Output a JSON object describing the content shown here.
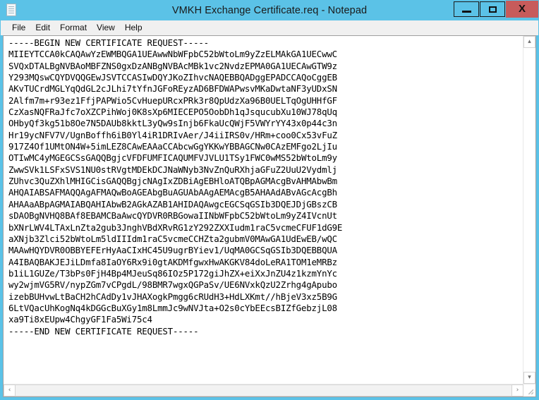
{
  "window": {
    "title": "VMKH Exchange Certificate.req - Notepad",
    "icon": "notepad-document-icon",
    "accent_color": "#5bc2e7",
    "close_button_color": "#c75b5b"
  },
  "titlebar_buttons": {
    "minimize": "–",
    "maximize": "□",
    "close": "X"
  },
  "menubar": {
    "items": [
      {
        "label": "File"
      },
      {
        "label": "Edit"
      },
      {
        "label": "Format"
      },
      {
        "label": "View"
      },
      {
        "label": "Help"
      }
    ]
  },
  "document": {
    "begin_marker": "-----BEGIN NEW CERTIFICATE REQUEST-----",
    "end_marker": "-----END NEW CERTIFICATE REQUEST-----",
    "body_lines": [
      "MIIEYTCCA0kCAQAwYzEWMBQGA1UEAwwNbWFpbC52bWtoLm9yZzELMAkGA1UECwwC",
      "SVQxDTALBgNVBAoMBFZNS0gxDzANBgNVBAcMBk1vc2NvdzEPMA0GA1UECAwGTW9z",
      "Y293MQswCQYDVQQGEwJSVTCCASIwDQYJKoZIhvcNAQEBBQADggEPADCCAQoCggEB",
      "AKvTUCrdMGLYqQdGL2cJLhi7tYfnJGFoREyzAD6BFDWAPwsvMKaDwtaNF3yUDxSN",
      "2Alfm7m+r93ez1FfjPAPWio5CvHuepURcxPRk3r8QpUdzXa96B0UELTqOgUHHfGF",
      "CzXasNQFRaJfc7oXZCPihWoj0K8sXp6MIECEPO5OobDh1qJsqucubXu10WJ78qUq",
      "OHbyQf3kg51b8Oe7N5DAUb8kktL3yQw9sInjb6FkaUcQWjF5VWYrYY43x0p44c3n",
      "Hr19ycNFV7V/UgnBoffh6iB0Yl4iR1DRIvAer/J4iiIRS0v/HRm+coo0Cx53vFuZ",
      "917Z4Of1UMtON4W+5imLEZ8CAwEAAaCCAbcwGgYKKwYBBAGCNw0CAzEMFgo2LjIu",
      "OTIwMC4yMGEGCSsGAQQBgjcVFDFUMFICAQUMFVJVLU1TSy1FWC0wMS52bWtoLm9y",
      "ZwwSVk1LSFxSVS1NU0stRVgtMDEkDCJNaWNyb3NvZnQuRXhjaGFuZ2UuU2Vydmlj",
      "ZUhvc3QuZXhlMHIGCisGAQQBgjcNAgIxZDBiAgEBHloATQBpAGMAcgBvAHMAbwBm",
      "AHQAIABSAFMAQQAgAFMAQwBoAGEAbgBuAGUAbAAgAEMAcgB5AHAAdABvAGcAcgBh",
      "AHAAaABpAGMAIABQAHIAbwB2AGkAZAB1AHIDAQAwgcEGCSqGSIb3DQEJDjGBszCB",
      "sDAOBgNVHQ8BAf8EBAMCBaAwcQYDVR0RBGowaIINbWFpbC52bWtoLm9yZ4IVcnUt",
      "bXNrLWV4LTAxLnZta2gub3JnghVBdXRvRG1zY292ZXXIudm1raC5vcmeCFUF1dG9E",
      "aXNjb3Zlci52bWtoLm5ldIIIdm1raC5vcmeCCHZta2gubmV0MAwGA1UdEwEB/wQC",
      "MAAwHQYDVR0OBBYEFErHyAaCIxHC45U9ugrBYiev1/UqMA0GCSqGSIb3DQEBBQUA",
      "A4IBAQBAKJEJiLDmfa8IaOY6Rx9i0gtAKDMfgwxHwAKGKV84doLeRA1TOM1eMRBz",
      "b1iL1GUZe/T3bPs0FjH4Bp4MJeuSq86IOz5P172giJhZX+eiXxJnZU4z1kzmYnYc",
      "wy2wjmVG5RV/nypZGm7vCPgdL/98BMR7wgxQGPaSv/UE6NVxkQzU2Zrhg4gApubo",
      "izebBUHvwLtBaCH2hCAdDy1vJHAXogkPmgg6cRUdH3+HdLXKmt//hBjeV3xz5B9G",
      "6LtVQacUhKogNq4kDGGcBuXGy1m8LmmJc9wNVJta+O2s0cYbEEcsBIZfGebzjL08",
      "xa9Ti8xEUpw4ChgyGF1Fa5Wi75c4"
    ]
  },
  "scrollbars": {
    "vertical_up_arrow": "▴",
    "vertical_down_arrow": "▾",
    "horizontal_left_arrow": "‹",
    "horizontal_right_arrow": "›",
    "resize_grip": "resize-grip"
  }
}
